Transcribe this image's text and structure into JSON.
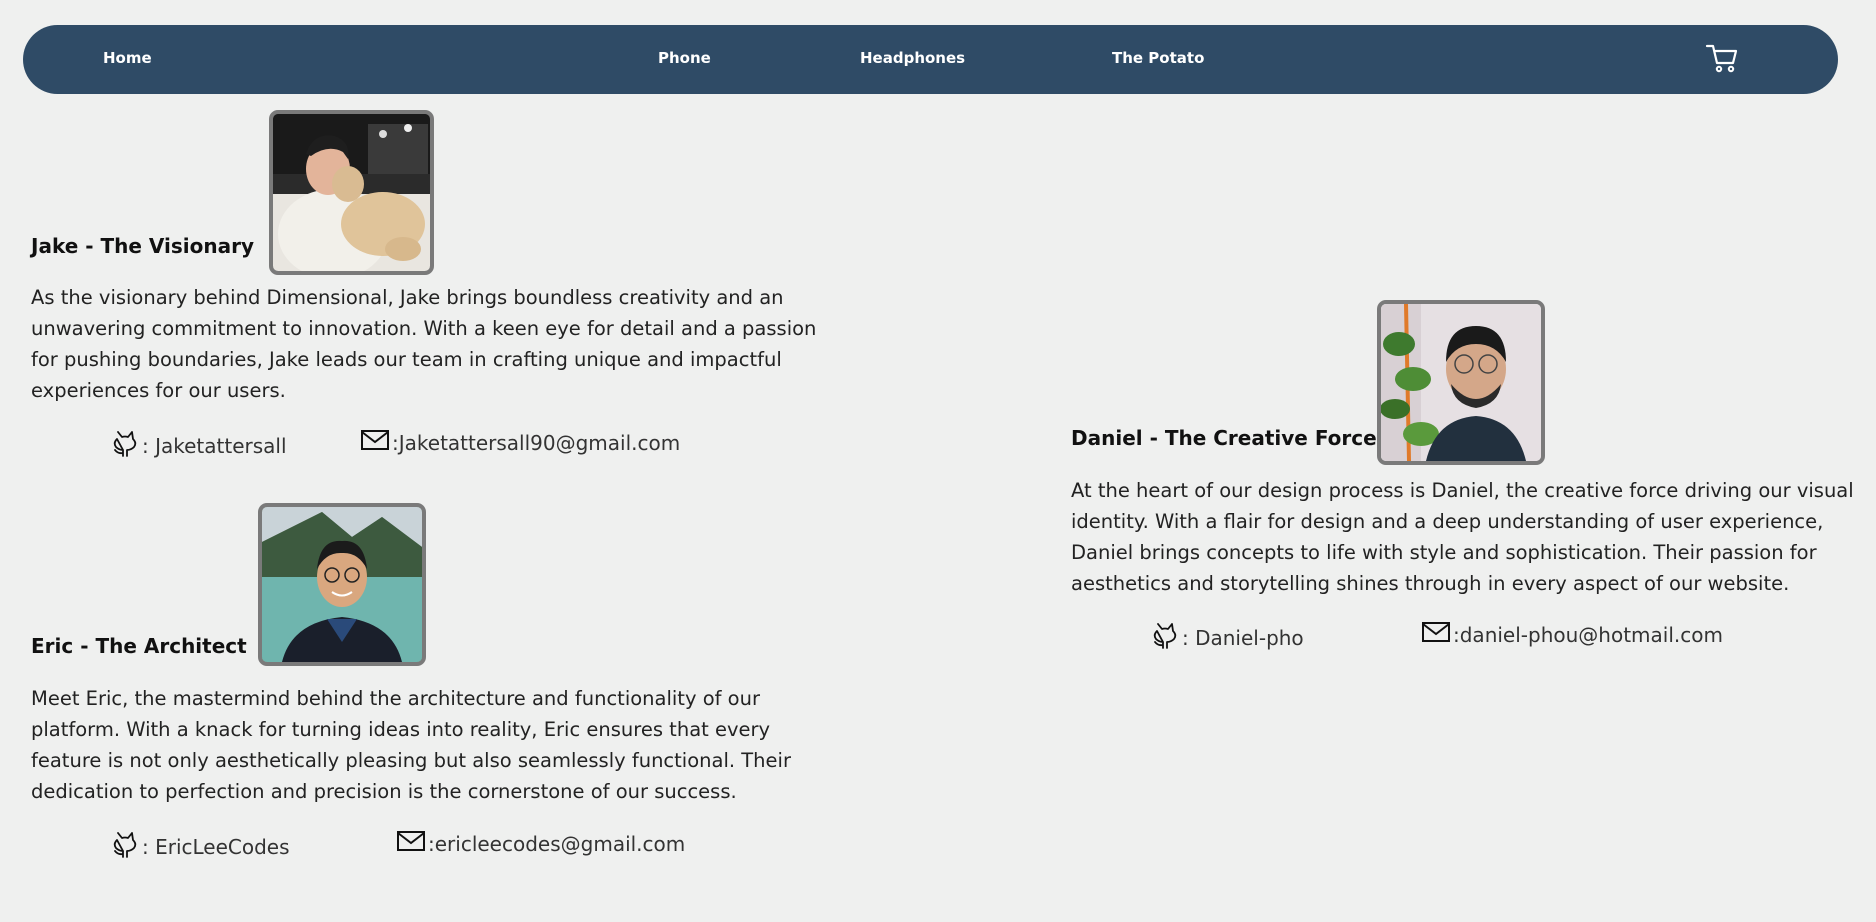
{
  "nav": {
    "links": [
      "Home",
      "Phone",
      "Headphones",
      "The Potato"
    ],
    "cart_icon": "cart-icon"
  },
  "team": [
    {
      "name": "Jake - The Visionary",
      "bio": "As the visionary behind Dimensional, Jake brings boundless creativity and an unwavering commitment to innovation. With a keen eye for detail and a passion for pushing boundaries, Jake leads our team in crafting unique and impactful experiences for our users.",
      "github": ": Jaketattersall",
      "email": ":Jaketattersall90@gmail.com"
    },
    {
      "name": "Eric - The Architect",
      "bio": "Meet Eric, the mastermind behind the architecture and functionality of our platform. With a knack for turning ideas into reality, Eric ensures that every feature is not only aesthetically pleasing but also seamlessly functional. Their dedication to perfection and precision is the cornerstone of our success.",
      "github": ": EricLeeCodes",
      "email": ":ericleecodes@gmail.com"
    },
    {
      "name": "Daniel - The Creative Force",
      "bio": "At the heart of our design process is Daniel, the creative force driving our visual identity. With a flair for design and a deep understanding of user experience, Daniel brings concepts to life with style and sophistication. Their passion for aesthetics and storytelling shines through in every aspect of our website.",
      "github": ": Daniel-pho",
      "email": ":daniel-phou@hotmail.com"
    }
  ],
  "colors": {
    "nav_bg": "#2f4b66",
    "page_bg": "#eff0ef",
    "photo_border": "#7a7a7a"
  }
}
